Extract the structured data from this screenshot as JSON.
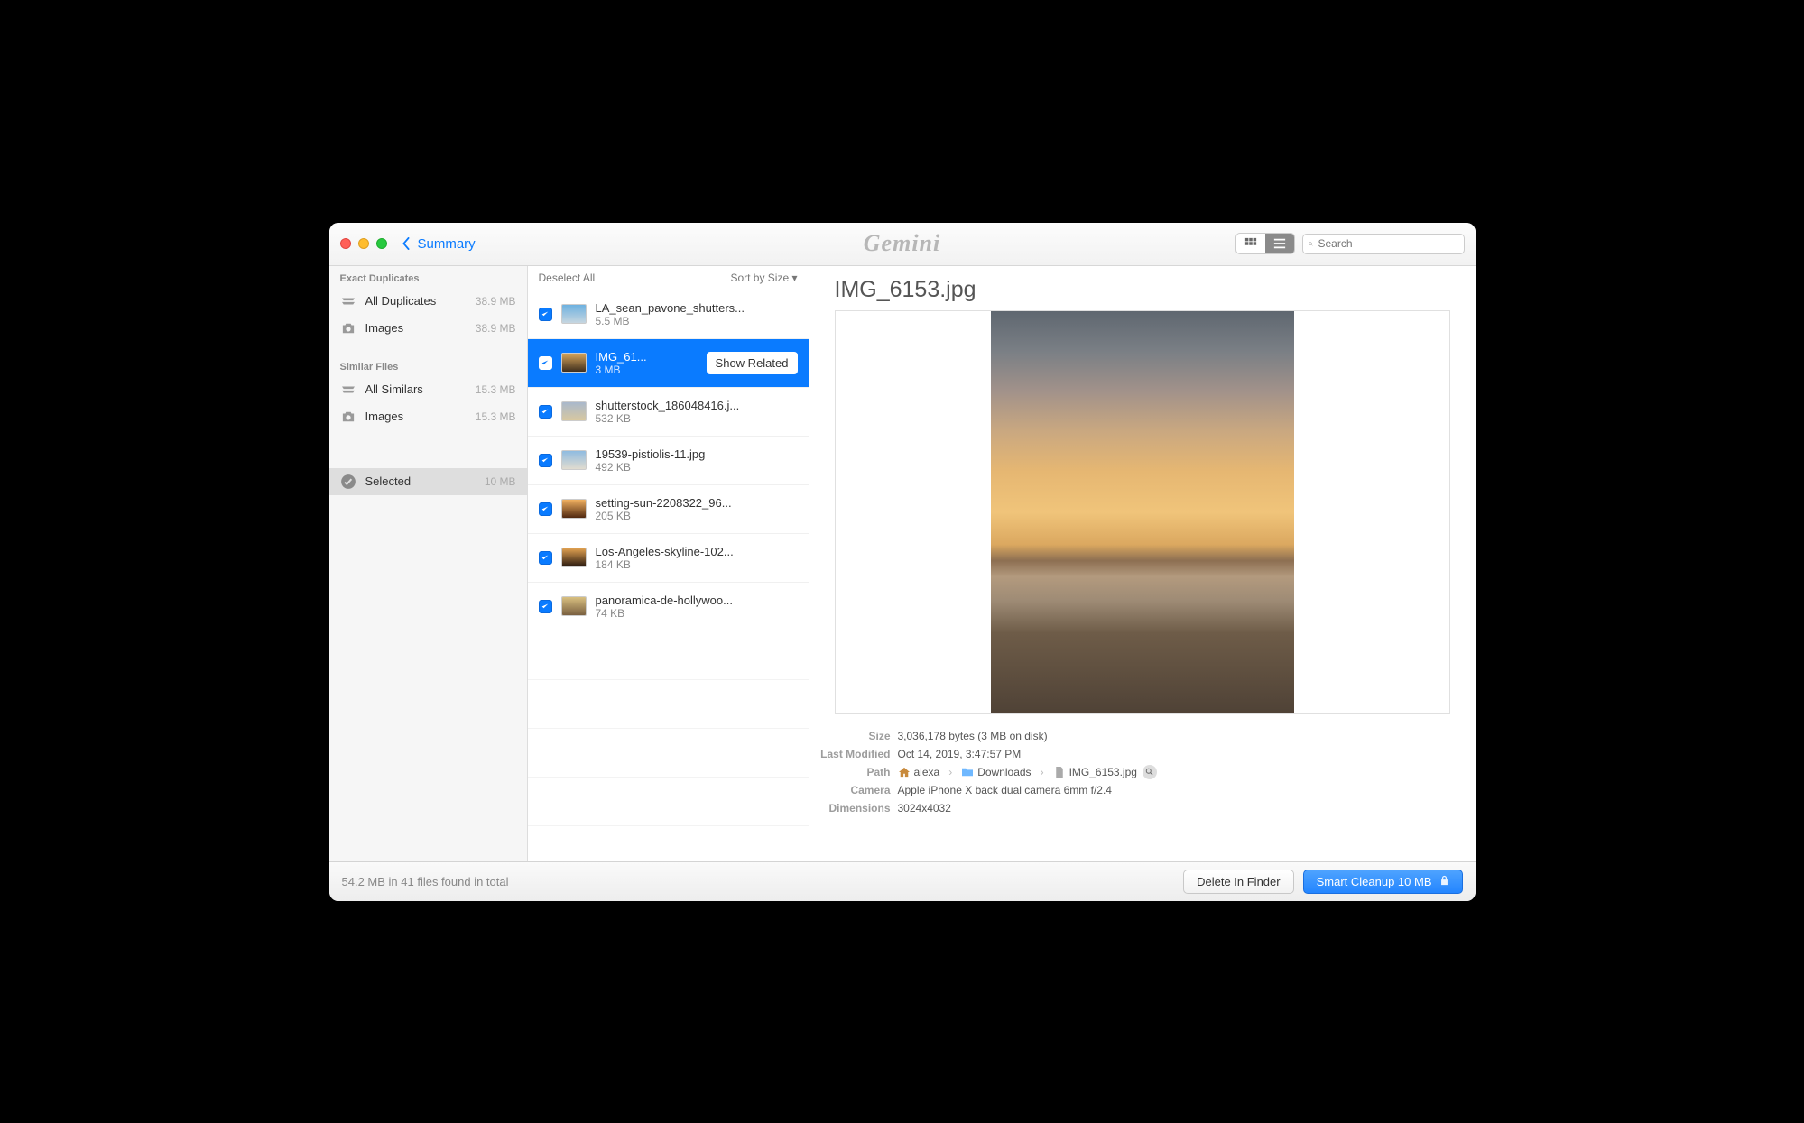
{
  "toolbar": {
    "back_label": "Summary",
    "app_name": "Gemini",
    "search_placeholder": "Search"
  },
  "sidebar": {
    "section1_header": "Exact Duplicates",
    "section1_items": [
      {
        "label": "All Duplicates",
        "size": "38.9 MB"
      },
      {
        "label": "Images",
        "size": "38.9 MB"
      }
    ],
    "section2_header": "Similar Files",
    "section2_items": [
      {
        "label": "All Similars",
        "size": "15.3 MB"
      },
      {
        "label": "Images",
        "size": "15.3 MB"
      }
    ],
    "selected_label": "Selected",
    "selected_size": "10 MB"
  },
  "filelist": {
    "deselect_label": "Deselect All",
    "sort_label": "Sort by Size ▾",
    "show_related_label": "Show Related",
    "rows": [
      {
        "name": "LA_sean_pavone_shutters...",
        "size": "5.5 MB",
        "thumb": "linear-gradient(#6db1e0,#c6d6e0)"
      },
      {
        "name": "IMG_61...",
        "size": "3 MB",
        "thumb": "linear-gradient(#d6a55a,#3e2e1d)"
      },
      {
        "name": "shutterstock_186048416.j...",
        "size": "532 KB",
        "thumb": "linear-gradient(#a9b8cc,#d8c8a0)"
      },
      {
        "name": "19539-pistiolis-11.jpg",
        "size": "492 KB",
        "thumb": "linear-gradient(#8fbbe0,#e1dcd0)"
      },
      {
        "name": "setting-sun-2208322_96...",
        "size": "205 KB",
        "thumb": "linear-gradient(#f0b060,#502810)"
      },
      {
        "name": "Los-Angeles-skyline-102...",
        "size": "184 KB",
        "thumb": "linear-gradient(#e0a050,#2a1a10)"
      },
      {
        "name": "panoramica-de-hollywoo...",
        "size": "74 KB",
        "thumb": "linear-gradient(#d9c080,#7a6040)"
      }
    ]
  },
  "preview": {
    "title": "IMG_6153.jpg",
    "meta": {
      "size_label": "Size",
      "size_value": "3,036,178 bytes (3 MB on disk)",
      "modified_label": "Last Modified",
      "modified_value": "Oct 14, 2019, 3:47:57 PM",
      "path_label": "Path",
      "path_parts": [
        "alexa",
        "Downloads",
        "IMG_6153.jpg"
      ],
      "camera_label": "Camera",
      "camera_value": "Apple iPhone X back dual camera 6mm f/2.4",
      "dimensions_label": "Dimensions",
      "dimensions_value": "3024x4032"
    }
  },
  "footer": {
    "status": "54.2 MB in 41 files found in total",
    "delete_label": "Delete In Finder",
    "cleanup_label": "Smart Cleanup 10 MB"
  }
}
